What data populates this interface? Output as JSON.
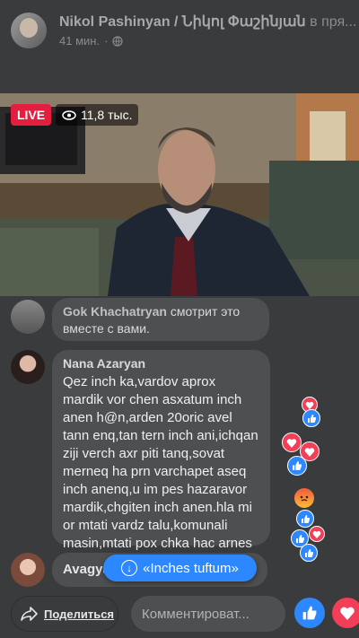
{
  "post": {
    "author": "Nikol Pashinyan / Նիկոլ Փաշինյան",
    "suffix": "в пря...",
    "time": "41 мин."
  },
  "video": {
    "live_label": "LIVE",
    "views": "11,8 тыс."
  },
  "comments": {
    "joined": {
      "name": "Gok Khachatryan",
      "text": " смотрит это вместе с вами."
    },
    "nana": {
      "name": "Nana Azaryan",
      "text": "Qez inch ka,vardov aprox mardik vor chen asxatum inch anen h@n,arden 20oric avel tann enq,tan tern inch ani,ichqan ziji verch axr piti tanq,sovat merneq ha prn varchapet aseq inch anenq,u im pes hazaravor mardik,chgiten inch anen.hla mi or mtati vardz talu,komunali masin,mtati pox chka hac arnes nor tenc xosa,qez inch ka"
    },
    "avag": {
      "name": "Avagya"
    }
  },
  "new_comment_pill": {
    "label": "«Inches tuftum»"
  },
  "bottom_bar": {
    "share_label": "Поделиться",
    "comment_placeholder": "Комментироват..."
  },
  "colors": {
    "live": "#e41e3f",
    "like": "#2d88ff",
    "love": "#f33e58"
  },
  "icons": [
    "globe-icon",
    "eye-icon",
    "share-icon",
    "like-icon",
    "love-icon",
    "angry-icon"
  ]
}
